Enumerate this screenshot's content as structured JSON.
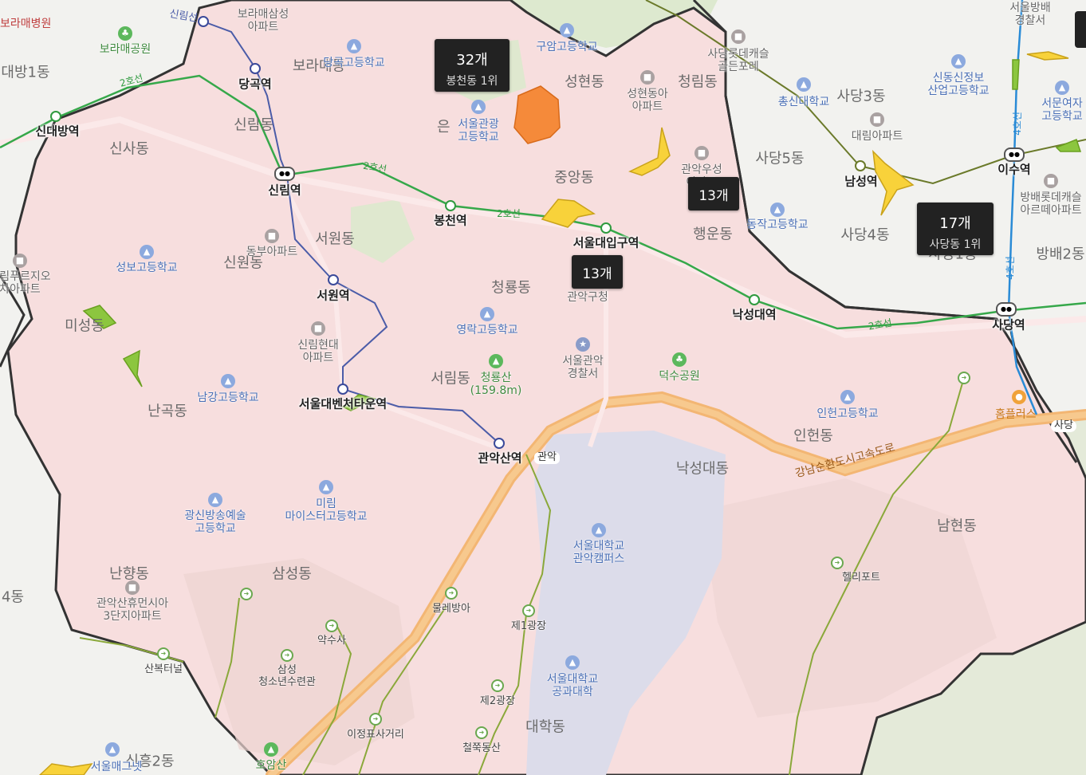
{
  "map": {
    "colors": {
      "district_fill": "#f7dede",
      "outside": "#f2f2ef",
      "boundary": "#333333",
      "lake": "#dcdcea",
      "line2": "#36a84a",
      "line_sillim": "#4b5ca8",
      "highway": "#f3b673",
      "hotspot_orange": "#f58a3a",
      "hotspot_yellow": "#f8d23a",
      "hotspot_green": "#8cc63f"
    },
    "dongs": [
      {
        "name": "신사동"
      },
      {
        "name": "신림동"
      },
      {
        "name": "보라매동"
      },
      {
        "name": "성현동"
      },
      {
        "name": "청림동"
      },
      {
        "name": "중앙동"
      },
      {
        "name": "서원동"
      },
      {
        "name": "신원동"
      },
      {
        "name": "청룡동"
      },
      {
        "name": "행운동"
      },
      {
        "name": "미성동"
      },
      {
        "name": "난곡동"
      },
      {
        "name": "서림동"
      },
      {
        "name": "인헌동"
      },
      {
        "name": "낙성대동"
      },
      {
        "name": "남현동"
      },
      {
        "name": "난향동"
      },
      {
        "name": "삼성동"
      },
      {
        "name": "대학동"
      },
      {
        "name": "사당3동"
      },
      {
        "name": "사당5동"
      },
      {
        "name": "사당4동"
      },
      {
        "name": "대방1동"
      },
      {
        "name": "사당1동"
      },
      {
        "name": "방배2동"
      },
      {
        "name": "신흥2동"
      },
      {
        "name": "4동"
      }
    ],
    "stations": [
      {
        "name": "당곡역"
      },
      {
        "name": "신대방역"
      },
      {
        "name": "신림역"
      },
      {
        "name": "봉천역"
      },
      {
        "name": "서울대입구역"
      },
      {
        "name": "낙성대역"
      },
      {
        "name": "서원역"
      },
      {
        "name": "서울대벤처타운역"
      },
      {
        "name": "관악산역"
      },
      {
        "name": "남성역"
      },
      {
        "name": "이수역"
      },
      {
        "name": "사당역"
      }
    ],
    "line_labels": {
      "line2": "2호선",
      "line4": "4호선",
      "sillim": "신림선"
    },
    "schools": [
      {
        "name": "당곡고등학교"
      },
      {
        "name": "구암고등학교"
      },
      {
        "name": "서울관광\n고등학교"
      },
      {
        "name": "성보고등학교"
      },
      {
        "name": "영락고등학교"
      },
      {
        "name": "남강고등학교"
      },
      {
        "name": "광신방송예술\n고등학교"
      },
      {
        "name": "미림\n마이스터고등학교"
      },
      {
        "name": "인헌고등학교"
      },
      {
        "name": "총신대학교"
      },
      {
        "name": "동작고등학교"
      },
      {
        "name": "신동신정보\n산업고등학교"
      },
      {
        "name": "서문여자\n고등학교"
      },
      {
        "name": "서울대학교\n관악캠퍼스"
      },
      {
        "name": "서울대학교\n공과대학"
      }
    ],
    "parks": [
      {
        "name": "보라매공원"
      },
      {
        "name": "청룡산\n(159.8m)"
      },
      {
        "name": "덕수공원"
      },
      {
        "name": "호암산"
      }
    ],
    "apartments": [
      {
        "name": "보라매삼성\n아파트"
      },
      {
        "name": "성현동아\n아파트"
      },
      {
        "name": "관악우성\n아파트"
      },
      {
        "name": "동부아파트"
      },
      {
        "name": "신림현대\n아파트"
      },
      {
        "name": "관악산휴먼시아\n3단지아파트"
      },
      {
        "name": "대림아파트"
      },
      {
        "name": "사당롯데캐슬\n골든포레"
      },
      {
        "name": "방배롯데캐슬\n아르떼아파트"
      },
      {
        "name": "신림푸르지오\n차아파트"
      }
    ],
    "others": [
      {
        "name": "관악구청"
      },
      {
        "name": "서울관악\n경찰서"
      },
      {
        "name": "서울방배\n경찰서"
      },
      {
        "name": "홈플러스"
      },
      {
        "name": "사당"
      },
      {
        "name": "관악"
      },
      {
        "name": "은"
      },
      {
        "name": "보라매병원"
      },
      {
        "name": "서울매그넷"
      }
    ],
    "trails": [
      {
        "name": "물레방아"
      },
      {
        "name": "제1광장"
      },
      {
        "name": "제2광장"
      },
      {
        "name": "약수사"
      },
      {
        "name": "삼성\n청소년수련관"
      },
      {
        "name": "산복터널"
      },
      {
        "name": "이정표사거리"
      },
      {
        "name": "철쭉동산"
      },
      {
        "name": "헬리포트"
      }
    ],
    "highway_label": "강남순환도시고속도로",
    "badges": [
      {
        "count": "32개",
        "rank": "봉천동 1위"
      },
      {
        "count": "13개",
        "rank": ""
      },
      {
        "count": "13개",
        "rank": ""
      },
      {
        "count": "17개",
        "rank": "사당동 1위"
      }
    ]
  }
}
